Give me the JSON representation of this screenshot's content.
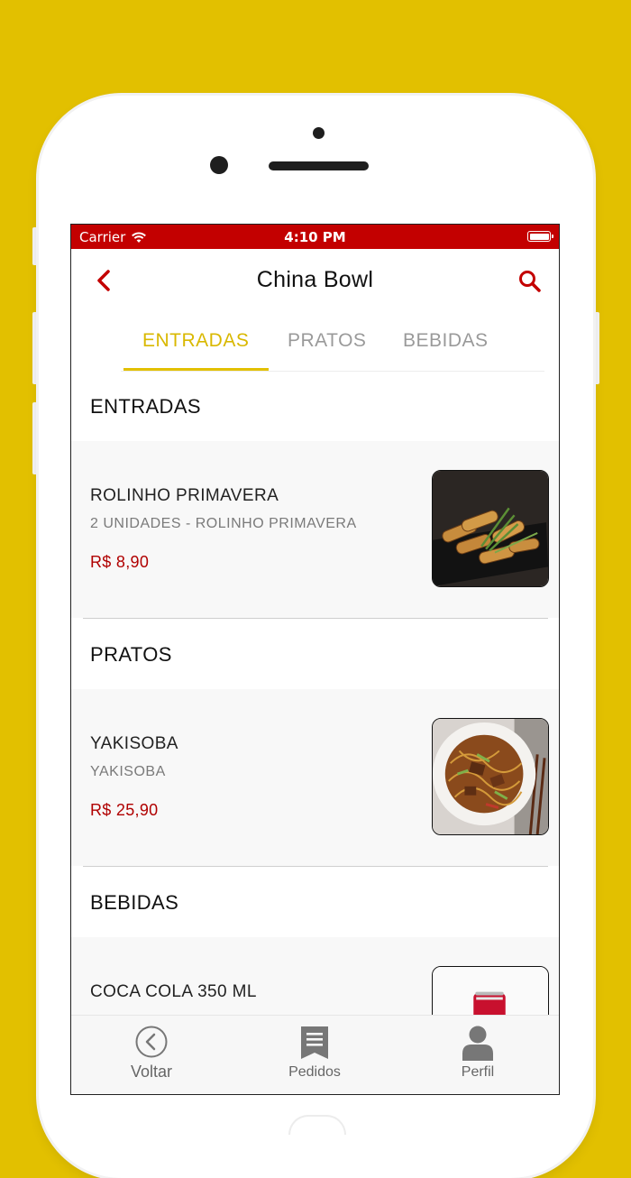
{
  "status_bar": {
    "carrier": "Carrier",
    "time": "4:10 PM"
  },
  "header": {
    "title": "China Bowl"
  },
  "tabs": [
    {
      "label": "ENTRADAS",
      "active": true
    },
    {
      "label": "PRATOS",
      "active": false
    },
    {
      "label": "BEBIDAS",
      "active": false
    }
  ],
  "sections": [
    {
      "title": "ENTRADAS",
      "items": [
        {
          "name": "ROLINHO PRIMAVERA",
          "description": "2 UNIDADES - ROLINHO PRIMAVERA",
          "price": "R$ 8,90",
          "image": "spring-rolls-photo"
        }
      ]
    },
    {
      "title": "PRATOS",
      "items": [
        {
          "name": "YAKISOBA",
          "description": "YAKISOBA",
          "price": "R$ 25,90",
          "image": "yakisoba-photo"
        }
      ]
    },
    {
      "title": "BEBIDAS",
      "items": [
        {
          "name": "COCA COLA 350 ML",
          "image": "coca-cola-can-photo"
        }
      ]
    }
  ],
  "bottom_nav": [
    {
      "label": "Voltar",
      "icon": "circle-chevron-left-icon"
    },
    {
      "label": "Pedidos",
      "icon": "receipt-icon"
    },
    {
      "label": "Perfil",
      "icon": "user-icon"
    }
  ],
  "colors": {
    "background": "#e2c000",
    "accent_red": "#c30000",
    "tab_active": "#d9b800",
    "price": "#b00000"
  }
}
